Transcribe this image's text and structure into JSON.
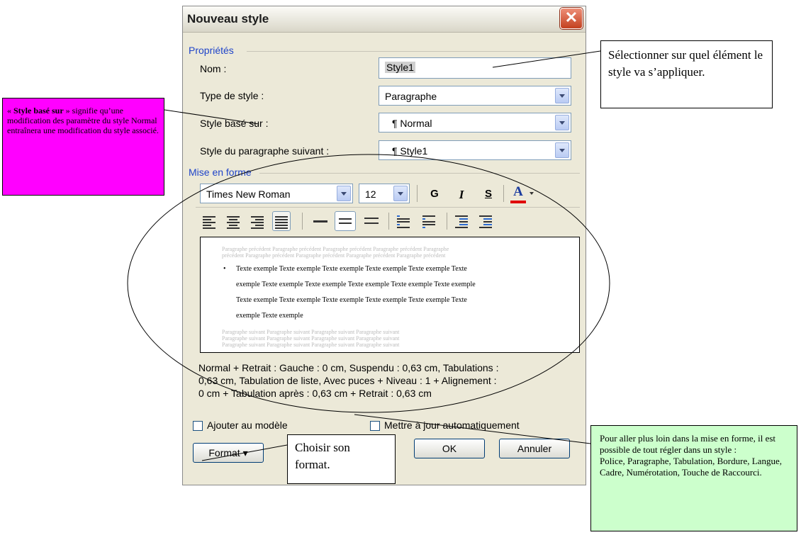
{
  "dialog": {
    "title": "Nouveau style",
    "close_glyph": "✕",
    "properties_group": "Propriétés",
    "name_label": "Nom :",
    "name_value": "Style1",
    "style_type_label": "Type de style :",
    "style_type_value": "Paragraphe",
    "based_on_label": "Style basé sur :",
    "based_on_value": "¶ Normal",
    "next_style_label": "Style du paragraphe suivant :",
    "next_style_value": "¶ Style1",
    "format_group": "Mise en forme",
    "font_value": "Times New Roman",
    "size_value": "12",
    "bold_glyph": "G",
    "italic_glyph": "I",
    "underline_glyph": "S",
    "color_glyph": "A",
    "preview": {
      "prev_line1": "Paragraphe précédent Paragraphe précédent Paragraphe précédent Paragraphe précédent Paragraphe",
      "prev_line2": "précédent Paragraphe précédent Paragraphe précédent Paragraphe précédent Paragraphe précédent",
      "sample_bullet": "•",
      "sample_lines": [
        "Texte exemple Texte exemple Texte exemple Texte exemple Texte exemple Texte",
        "exemple Texte exemple Texte exemple Texte exemple Texte exemple Texte exemple",
        "Texte exemple Texte exemple Texte exemple Texte exemple Texte exemple Texte",
        "exemple Texte exemple"
      ],
      "next_line1": "Paragraphe suivant Paragraphe suivant Paragraphe suivant Paragraphe suivant",
      "next_line2": "Paragraphe suivant Paragraphe suivant Paragraphe suivant Paragraphe suivant",
      "next_line3": "Paragraphe suivant Paragraphe suivant Paragraphe suivant Paragraphe suivant"
    },
    "description_lines": [
      "Normal + Retrait : Gauche :  0 cm, Suspendu : 0,63 cm, Tabulations :",
      "0,63 cm, Tabulation de liste, Avec puces + Niveau : 1 + Alignement :",
      "0 cm + Tabulation après :  0,63 cm + Retrait :  0,63 cm"
    ],
    "add_to_template_label": "Ajouter au modèle",
    "auto_update_label": "Mettre à jour automatiquement",
    "format_button": "Format ▾",
    "ok_button": "OK",
    "cancel_button": "Annuler"
  },
  "callouts": {
    "select_element": "Sélectionner sur quel élément le style va s’appliquer.",
    "based_on_prefix": "« ",
    "based_on_bold": "Style basé sur",
    "based_on_rest": " » signifie qu’une modification des paramètre du style Normal entraînera une modification du style associé.",
    "choose_format": "Choisir son format.",
    "further_formatting": "Pour aller plus loin dans la mise en forme, il est possible de tout régler dans un style :",
    "further_formatting_list": "Police, Paragraphe, Tabulation, Bordure, Langue, Cadre, Numérotation, Touche de Raccourci."
  },
  "colors": {
    "magenta_callout": "#ff00ff",
    "green_callout": "#ccffcc",
    "group_label": "#1f44c9",
    "font_color_bar": "#e00000"
  }
}
